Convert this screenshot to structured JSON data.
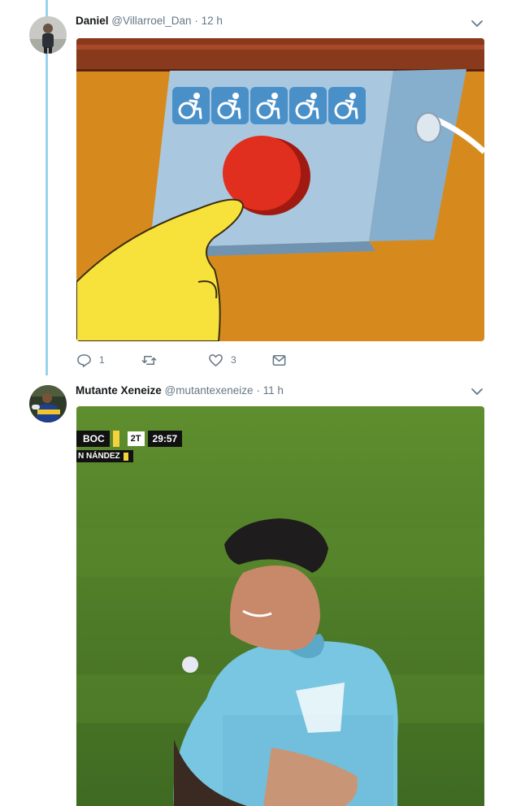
{
  "tweets": [
    {
      "author_name": "Daniel",
      "handle": "@Villarroel_Dan",
      "separator": "·",
      "time": "12 h",
      "icons": [
        "avatar-photo",
        "chevron-down-icon",
        "accessible-forward-emoji"
      ],
      "actions": {
        "reply_count": "1",
        "retweet_count": "",
        "like_count": "3"
      }
    },
    {
      "author_name": "Mutante Xeneize",
      "handle": "@mutantexeneize",
      "separator": "·",
      "time": "11 h",
      "scoreboard": {
        "team": "BOC",
        "half": "2T",
        "clock": "29:57",
        "player": "N NÁNDEZ"
      }
    }
  ],
  "colors": {
    "thread_line": "#9ad1ec",
    "muted_text": "#657786",
    "emoji_blue": "#4a90c8",
    "card_bg": "#ffffff"
  }
}
